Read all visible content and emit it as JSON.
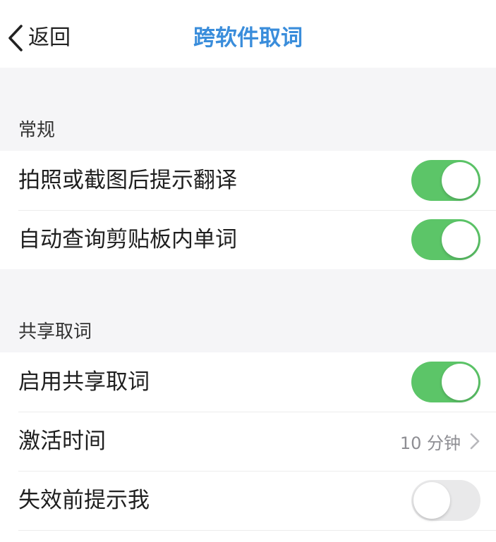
{
  "navbar": {
    "back_label": "返回",
    "title": "跨软件取词"
  },
  "colors": {
    "accent": "#3a8ddb",
    "toggle_on": "#5cc568",
    "toggle_off": "#e9e9ea"
  },
  "sections": [
    {
      "header": "常规",
      "rows": [
        {
          "label": "拍照或截图后提示翻译",
          "toggle": true
        },
        {
          "label": "自动查询剪贴板内单词",
          "toggle": true
        }
      ]
    },
    {
      "header": "共享取词",
      "rows": [
        {
          "label": "启用共享取词",
          "toggle": true
        },
        {
          "label": "激活时间",
          "value": "10 分钟",
          "icon": "chevron-right-icon"
        },
        {
          "label": "失效前提示我",
          "toggle": false
        }
      ]
    }
  ]
}
